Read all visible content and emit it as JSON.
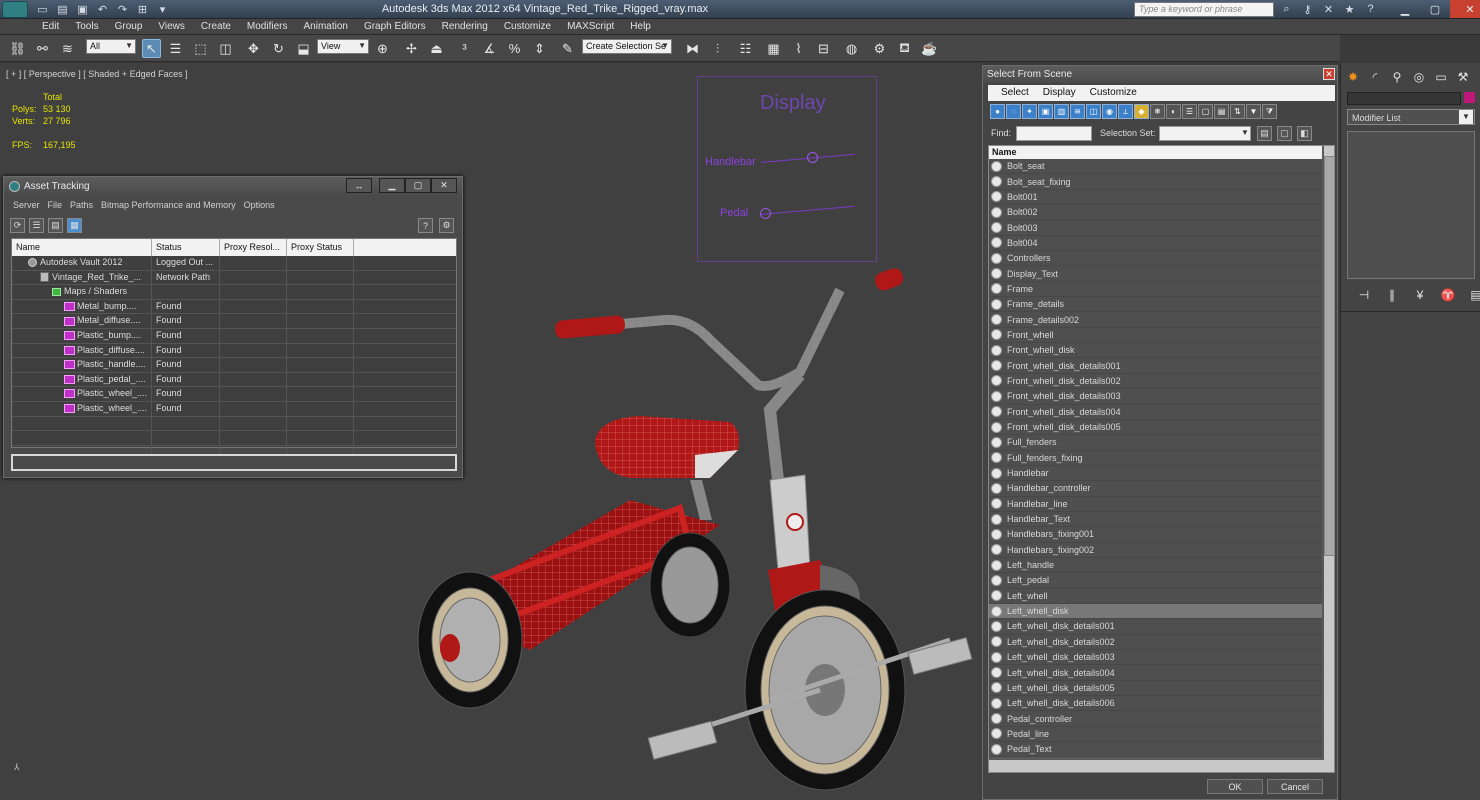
{
  "app": {
    "title": "Autodesk 3ds Max  2012 x64     Vintage_Red_Trike_Rigged_vray.max",
    "search_placeholder": "Type a keyword or phrase"
  },
  "menu": [
    "Edit",
    "Tools",
    "Group",
    "Views",
    "Create",
    "Modifiers",
    "Animation",
    "Graph Editors",
    "Rendering",
    "Customize",
    "MAXScript",
    "Help"
  ],
  "toolbar": {
    "filter": "All",
    "ref_coord": "View",
    "selection_set": "Create Selection Se"
  },
  "viewport": {
    "label": "[ + ] [ Perspective ] [ Shaded + Edged Faces ]",
    "stats_header": "Total",
    "polys_label": "Polys:",
    "polys": "53 130",
    "verts_label": "Verts:",
    "verts": "27 796",
    "fps_label": "FPS:",
    "fps": "167,195",
    "display": {
      "title": "Display",
      "handlebar": "Handlebar",
      "pedal": "Pedal",
      "handlebar_value": 0.55,
      "pedal_value": 0.05
    }
  },
  "asset_tracking": {
    "title": "Asset Tracking",
    "menu": [
      "Server",
      "File",
      "Paths",
      "Bitmap Performance and Memory",
      "Options"
    ],
    "columns": [
      "Name",
      "Status",
      "Proxy Resol...",
      "Proxy Status"
    ],
    "rows": [
      {
        "name": "Autodesk Vault 2012",
        "status": "Logged Out ...",
        "icon": "vault-icon",
        "indent": 1
      },
      {
        "name": "Vintage_Red_Trike_...",
        "status": "Network Path",
        "icon": "document-icon",
        "indent": 2
      },
      {
        "name": "Maps / Shaders",
        "status": "",
        "icon": "maps-icon",
        "indent": 3
      },
      {
        "name": "Metal_bump....",
        "status": "Found",
        "icon": "png-icon",
        "indent": 4
      },
      {
        "name": "Metal_diffuse....",
        "status": "Found",
        "icon": "png-icon",
        "indent": 4
      },
      {
        "name": "Plastic_bump....",
        "status": "Found",
        "icon": "png-icon",
        "indent": 4
      },
      {
        "name": "Plastic_diffuse....",
        "status": "Found",
        "icon": "png-icon",
        "indent": 4
      },
      {
        "name": "Plastic_handle....",
        "status": "Found",
        "icon": "png-icon",
        "indent": 4
      },
      {
        "name": "Plastic_pedal_....",
        "status": "Found",
        "icon": "png-icon",
        "indent": 4
      },
      {
        "name": "Plastic_wheel_....",
        "status": "Found",
        "icon": "png-icon",
        "indent": 4
      },
      {
        "name": "Plastic_wheel_....",
        "status": "Found",
        "icon": "png-icon",
        "indent": 4
      },
      {
        "name": "",
        "status": "",
        "icon": "",
        "indent": 0
      },
      {
        "name": "",
        "status": "",
        "icon": "",
        "indent": 0
      },
      {
        "name": "",
        "status": "",
        "icon": "",
        "indent": 0
      }
    ]
  },
  "select_from_scene": {
    "title": "Select From Scene",
    "tabs": [
      "Select",
      "Display",
      "Customize"
    ],
    "find_label": "Find:",
    "selection_set_label": "Selection Set:",
    "name_header": "Name",
    "ok": "OK",
    "cancel": "Cancel",
    "selected_index": 29,
    "objects": [
      "Bolt_seat",
      "Bolt_seat_fixing",
      "Bolt001",
      "Bolt002",
      "Bolt003",
      "Bolt004",
      "Controllers",
      "Display_Text",
      "Frame",
      "Frame_details",
      "Frame_details002",
      "Front_whell",
      "Front_whell_disk",
      "Front_whell_disk_details001",
      "Front_whell_disk_details002",
      "Front_whell_disk_details003",
      "Front_whell_disk_details004",
      "Front_whell_disk_details005",
      "Full_fenders",
      "Full_fenders_fixing",
      "Handlebar",
      "Handlebar_controller",
      "Handlebar_line",
      "Handlebar_Text",
      "Handlebars_fixing001",
      "Handlebars_fixing002",
      "Left_handle",
      "Left_pedal",
      "Left_whell",
      "Left_whell_disk",
      "Left_whell_disk_details001",
      "Left_whell_disk_details002",
      "Left_whell_disk_details003",
      "Left_whell_disk_details004",
      "Left_whell_disk_details005",
      "Left_whell_disk_details006",
      "Pedal_controller",
      "Pedal_line",
      "Pedal_Text"
    ]
  },
  "command_panel": {
    "modifier_list": "Modifier List",
    "color": "#c01878"
  },
  "colors": {
    "accent": "#5c8bb5",
    "stats_text": "#e4e400",
    "display_purple": "#8c42e0",
    "trike_red": "#b01818"
  }
}
